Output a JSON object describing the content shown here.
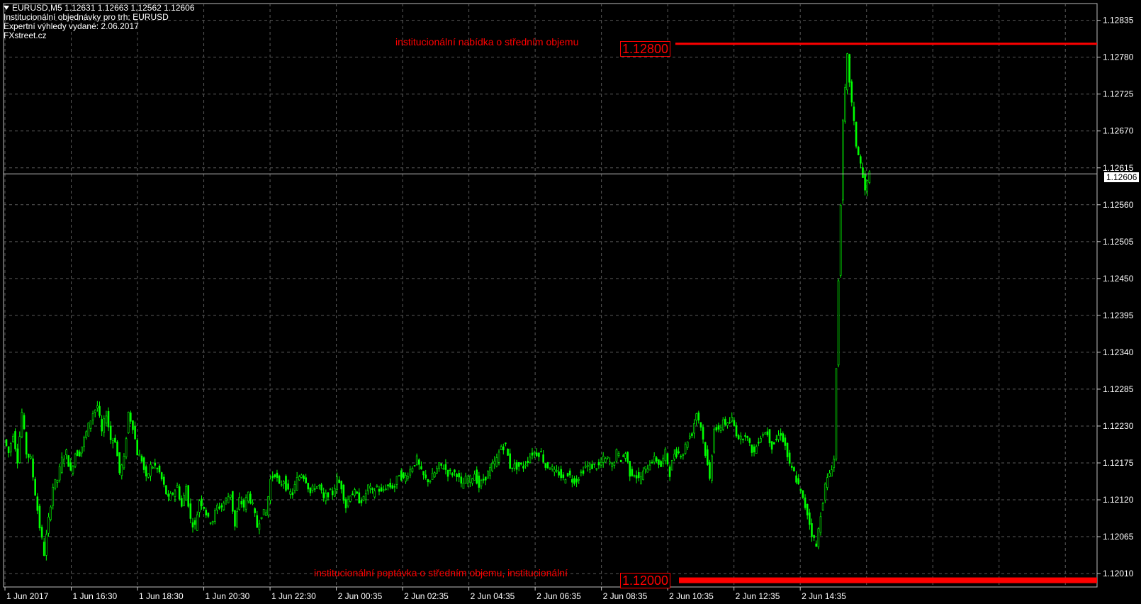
{
  "header": {
    "symbol_line": "EURUSD,M5  1.12631 1.12663 1.12562 1.12606",
    "line2": "Institucionální objednávky pro trh: EURUSD",
    "line3": "Expertní výhledy vydané: 2.06.2017",
    "line4": "FXstreet.cz"
  },
  "annotations": {
    "offer_label": "institucionální nabídka o středním objemu",
    "offer_price": "1.12800",
    "bid_label": "institucionální poptávka o středním objemu, institucionální",
    "bid_price": "1.12000",
    "current_price": "1.12606"
  },
  "colors": {
    "background": "#000000",
    "grid": "#5a5a5a",
    "candles": "#00ff00",
    "levels": "#ff0000",
    "current_line": "#c0c0c0"
  },
  "chart_data": {
    "type": "line",
    "symbol": "EURUSD",
    "timeframe": "M5",
    "ylim": [
      1.1199,
      1.1286
    ],
    "y_ticks": [
      "1.12835",
      "1.12780",
      "1.12725",
      "1.12670",
      "1.12615",
      "1.12560",
      "1.12505",
      "1.12450",
      "1.12395",
      "1.12340",
      "1.12285",
      "1.12230",
      "1.12175",
      "1.12120",
      "1.12065",
      "1.12010"
    ],
    "x_ticks": [
      "1 Jun 2017",
      "1 Jun 16:30",
      "1 Jun 18:30",
      "1 Jun 20:30",
      "1 Jun 22:30",
      "2 Jun 00:35",
      "2 Jun 02:35",
      "2 Jun 04:35",
      "2 Jun 06:35",
      "2 Jun 08:35",
      "2 Jun 10:35",
      "2 Jun 12:35",
      "2 Jun 14:35"
    ],
    "grid": true,
    "horizontal_levels": [
      {
        "price": 1.128,
        "label": "institucionální nabídka o středním objemu"
      },
      {
        "price": 1.12,
        "label": "institucionální poptávka o středním objemu, institucionální"
      }
    ],
    "last_price": 1.12606,
    "price_path": [
      1.1221,
      1.1219,
      1.1222,
      1.1218,
      1.1225,
      1.1219,
      1.1218,
      1.1213,
      1.1208,
      1.1204,
      1.1209,
      1.1214,
      1.1215,
      1.1218,
      1.1219,
      1.1216,
      1.1219,
      1.1219,
      1.1221,
      1.1223,
      1.1225,
      1.1226,
      1.1222,
      1.1225,
      1.1221,
      1.1221,
      1.1216,
      1.1218,
      1.1225,
      1.1223,
      1.1219,
      1.1218,
      1.1215,
      1.1217,
      1.1217,
      1.1216,
      1.1214,
      1.1212,
      1.1213,
      1.1214,
      1.1211,
      1.1214,
      1.1209,
      1.1208,
      1.1212,
      1.1211,
      1.1209,
      1.1209,
      1.1211,
      1.1211,
      1.1212,
      1.1213,
      1.1208,
      1.1212,
      1.1211,
      1.1213,
      1.1211,
      1.1208,
      1.121,
      1.121,
      1.1215,
      1.1216,
      1.1214,
      1.1215,
      1.1213,
      1.1213,
      1.1215,
      1.1216,
      1.1215,
      1.1213,
      1.1214,
      1.1214,
      1.1212,
      1.1213,
      1.1213,
      1.1215,
      1.1214,
      1.1211,
      1.1213,
      1.1213,
      1.1212,
      1.1212,
      1.1214,
      1.1213,
      1.1214,
      1.1213,
      1.1214,
      1.1214,
      1.1214,
      1.1216,
      1.1215,
      1.1216,
      1.1217,
      1.1218,
      1.1216,
      1.1215,
      1.1215,
      1.1216,
      1.1217,
      1.1217,
      1.1216,
      1.1216,
      1.1216,
      1.1214,
      1.1215,
      1.1215,
      1.1216,
      1.1214,
      1.1215,
      1.1216,
      1.1217,
      1.1218,
      1.122,
      1.122,
      1.1217,
      1.1217,
      1.1217,
      1.1217,
      1.1218,
      1.1219,
      1.1219,
      1.1219,
      1.1217,
      1.1217,
      1.1216,
      1.1216,
      1.1215,
      1.1216,
      1.1215,
      1.1215,
      1.1216,
      1.1217,
      1.1217,
      1.1217,
      1.1217,
      1.1218,
      1.1218,
      1.1217,
      1.1219,
      1.1218,
      1.1219,
      1.1216,
      1.1216,
      1.1215,
      1.1216,
      1.1217,
      1.1218,
      1.1218,
      1.1217,
      1.1219,
      1.1216,
      1.1219,
      1.1219,
      1.1219,
      1.1221,
      1.1222,
      1.1225,
      1.1223,
      1.1219,
      1.1215,
      1.1223,
      1.1222,
      1.1224,
      1.1223,
      1.1224,
      1.1222,
      1.1221,
      1.1222,
      1.122,
      1.1219,
      1.1221,
      1.1222,
      1.1222,
      1.122,
      1.1221,
      1.1222,
      1.122,
      1.1217,
      1.1216,
      1.1214,
      1.1212,
      1.121,
      1.1207,
      1.1205,
      1.121,
      1.1214,
      1.1216,
      1.1218,
      1.1245,
      1.1268,
      1.1278,
      1.1271,
      1.1265,
      1.1262,
      1.1258,
      1.12606
    ]
  }
}
